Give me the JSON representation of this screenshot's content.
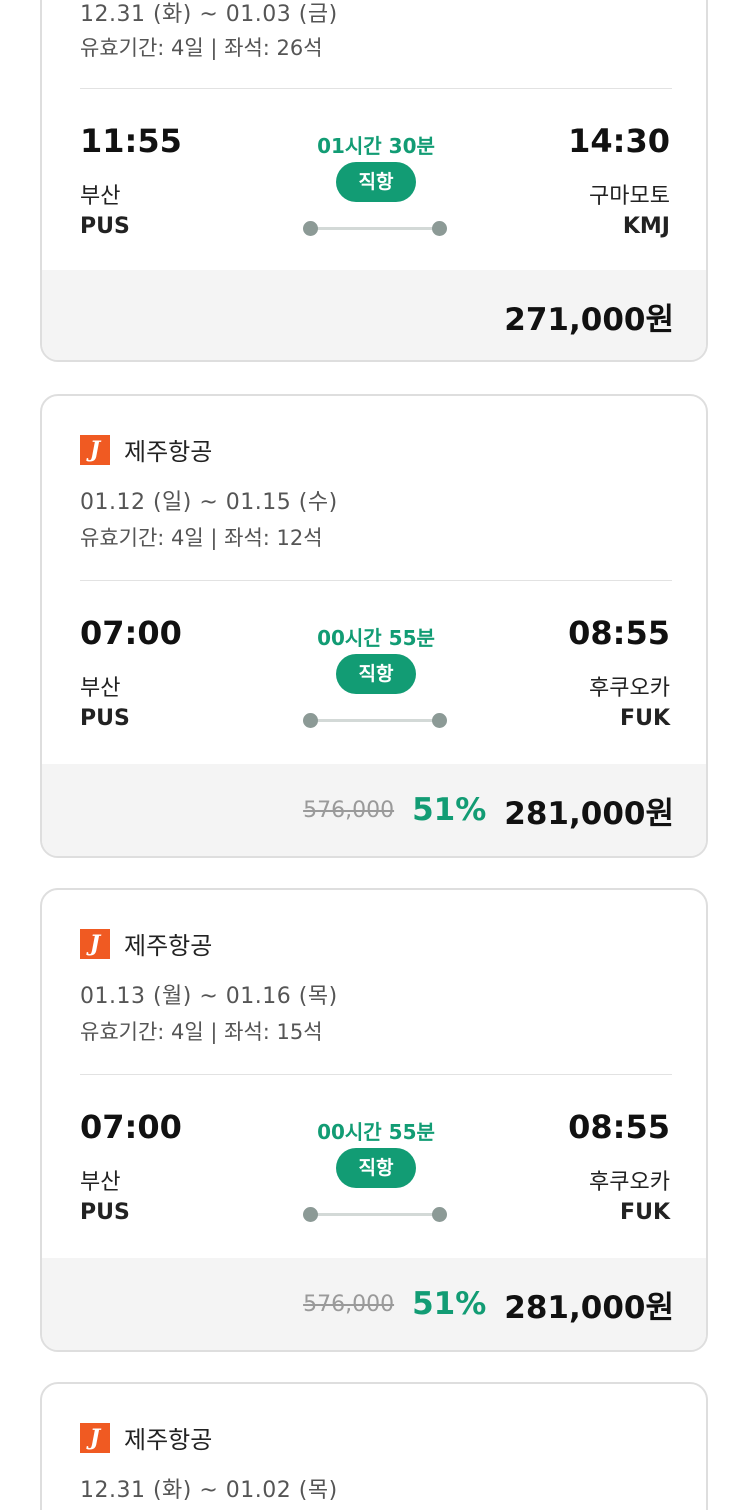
{
  "cards": [
    {
      "airline": "",
      "dates": "12.31 (화) ~ 01.03 (금)",
      "validity": "유효기간: 4일 | 좌석: 26석",
      "depart_time": "11:55",
      "depart_city": "부산",
      "depart_code": "PUS",
      "duration": "01시간 30분",
      "flight_type": "직항",
      "arrive_time": "14:30",
      "arrive_city": "구마모토",
      "arrive_code": "KMJ",
      "original_price": "",
      "discount": "",
      "price": "271,000원"
    },
    {
      "airline": "제주항공",
      "dates": "01.12 (일) ~ 01.15 (수)",
      "validity": "유효기간: 4일 | 좌석: 12석",
      "depart_time": "07:00",
      "depart_city": "부산",
      "depart_code": "PUS",
      "duration": "00시간 55분",
      "flight_type": "직항",
      "arrive_time": "08:55",
      "arrive_city": "후쿠오카",
      "arrive_code": "FUK",
      "original_price": "576,000",
      "discount": "51%",
      "price": "281,000원"
    },
    {
      "airline": "제주항공",
      "dates": "01.13 (월) ~ 01.16 (목)",
      "validity": "유효기간: 4일 | 좌석: 15석",
      "depart_time": "07:00",
      "depart_city": "부산",
      "depart_code": "PUS",
      "duration": "00시간 55분",
      "flight_type": "직항",
      "arrive_time": "08:55",
      "arrive_city": "후쿠오카",
      "arrive_code": "FUK",
      "original_price": "576,000",
      "discount": "51%",
      "price": "281,000원"
    },
    {
      "airline": "제주항공",
      "dates": "12.31 (화) ~ 01.02 (목)"
    }
  ],
  "logo_letter": "J",
  "colors": {
    "accent": "#129c74",
    "logo": "#f05a22",
    "border": "#dedede",
    "price_bar": "#f4f4f4"
  }
}
